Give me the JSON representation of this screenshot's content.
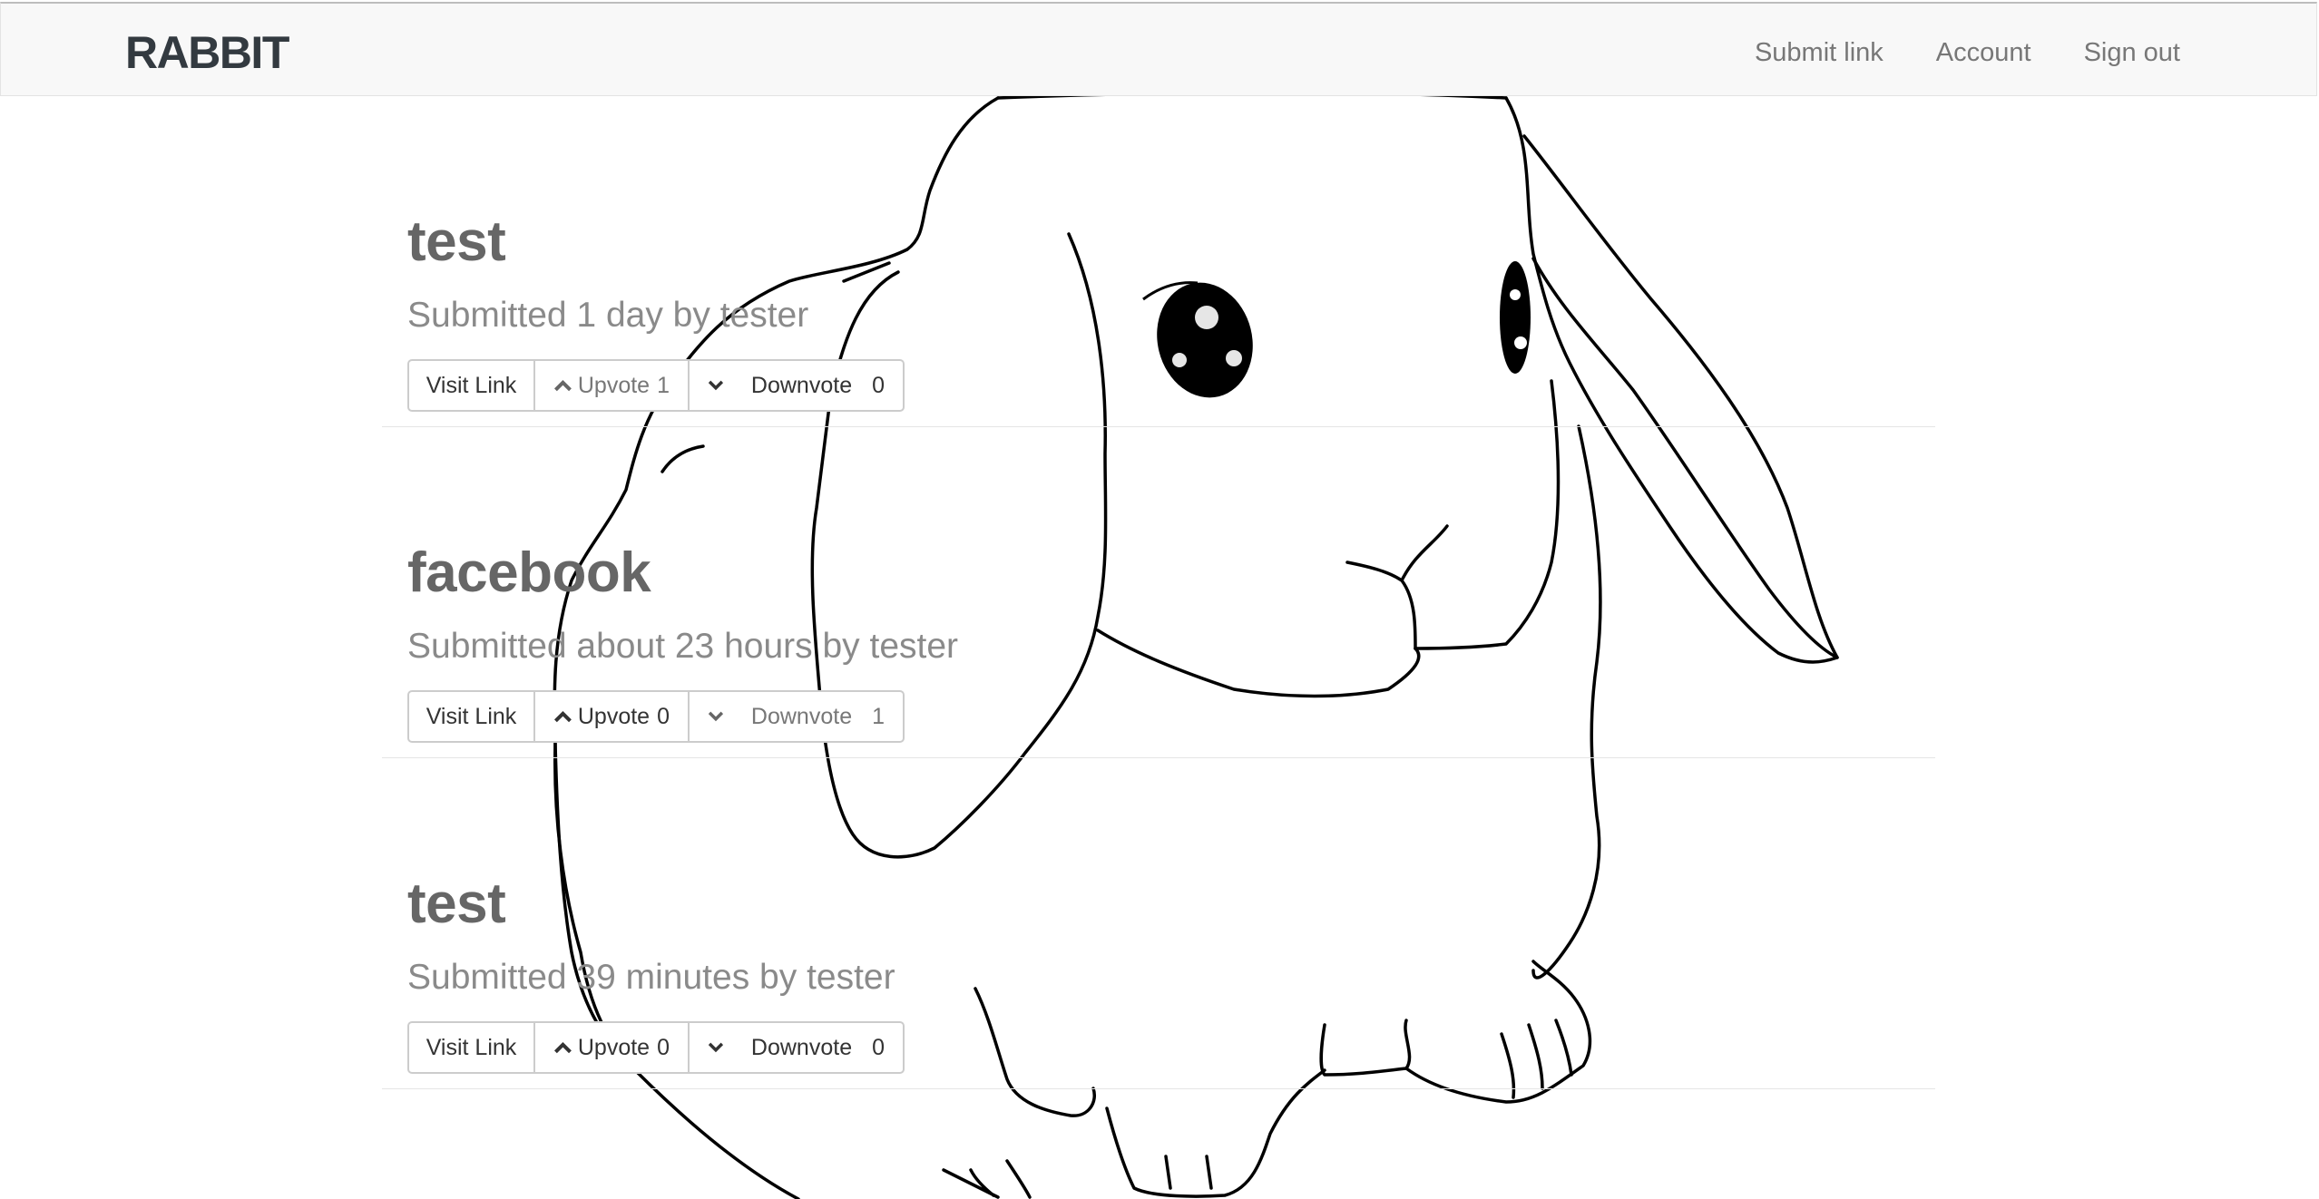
{
  "brand": "RABBIT",
  "nav": [
    {
      "label": "Submit link"
    },
    {
      "label": "Account"
    },
    {
      "label": "Sign out"
    }
  ],
  "posts": [
    {
      "title": "test",
      "meta": "Submitted 1 day by tester",
      "visit_label": "Visit Link",
      "upvote_label": "Upvote",
      "upvotes": "1",
      "downvote_label": "Downvote",
      "downvotes": "0"
    },
    {
      "title": "facebook",
      "meta": "Submitted about 23 hours by tester",
      "visit_label": "Visit Link",
      "upvote_label": "Upvote",
      "upvotes": "0",
      "downvote_label": "Downvote",
      "downvotes": "1"
    },
    {
      "title": "test",
      "meta": "Submitted 39 minutes by tester",
      "visit_label": "Visit Link",
      "upvote_label": "Upvote",
      "upvotes": "0",
      "downvote_label": "Downvote",
      "downvotes": "0"
    }
  ],
  "icons": {
    "upvote": "chevron-up-icon",
    "downvote": "chevron-down-icon"
  }
}
